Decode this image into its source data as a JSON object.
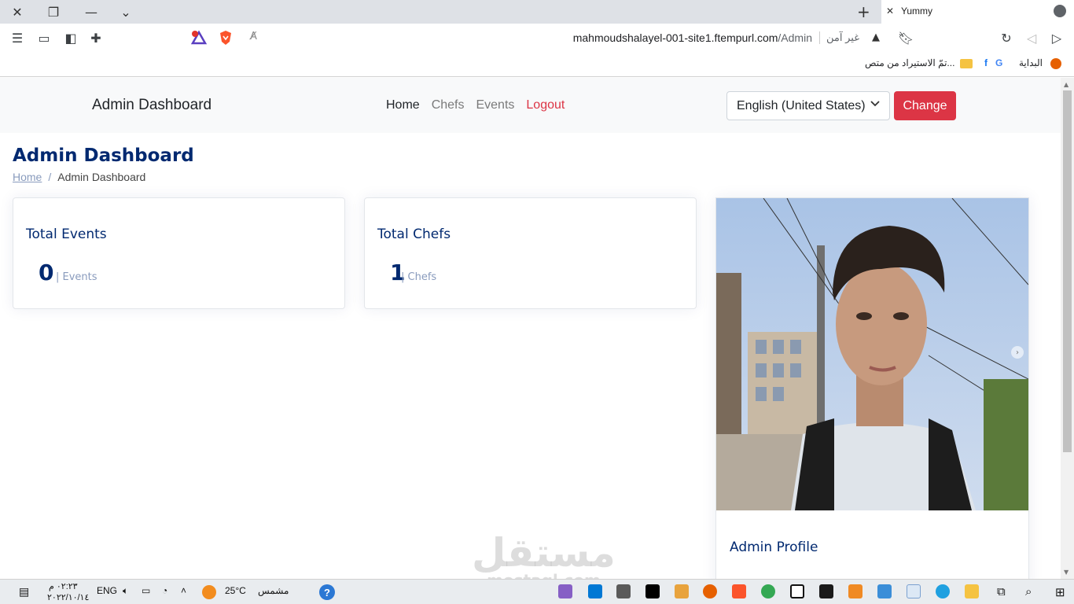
{
  "browser": {
    "tab_title": "Yummy",
    "url_host": "mahmoudshalayel-001-site1.ftempurl.com",
    "url_path": "/Admin",
    "security_label": "غير آمن",
    "bookmarks": [
      "البداية",
      "تمّ الاستيراد من متص..."
    ]
  },
  "navbar": {
    "brand": "Admin Dashboard",
    "links": [
      "Home",
      "Chefs",
      "Events",
      "Logout"
    ],
    "language_selected": "English (United States)",
    "change_label": "Change"
  },
  "page": {
    "title": "Admin Dashboard",
    "breadcrumb": [
      "Home",
      "Admin Dashboard"
    ]
  },
  "cards": [
    {
      "title": "Total Events",
      "value": "0",
      "unit": "| Events"
    },
    {
      "title": "Total Chefs",
      "value": "1",
      "unit": "| Chefs"
    }
  ],
  "profile": {
    "title": "Admin Profile"
  },
  "watermark": {
    "arabic": "مستقل",
    "latin": "mostaql.com"
  },
  "taskbar": {
    "time": "٠٢:٢٣ م",
    "date": "٢٠٢٢/١٠/١٤",
    "language": "ENG",
    "temperature": "25°C",
    "weather": "مشمس"
  },
  "colors": {
    "accent": "#dc3545",
    "heading": "#012970",
    "muted": "#899bbd"
  }
}
